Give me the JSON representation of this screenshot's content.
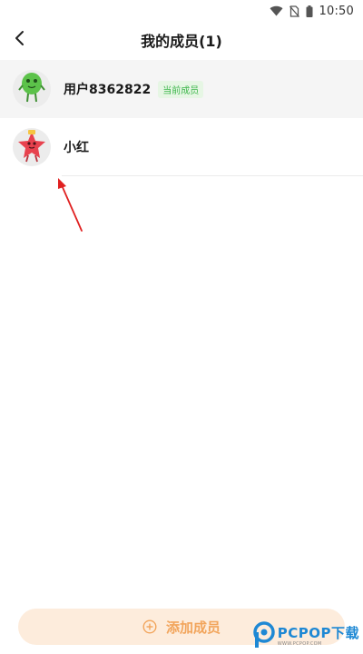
{
  "status_bar": {
    "time": "10:50",
    "icons": [
      "wifi-icon",
      "no-sim-icon",
      "battery-icon"
    ]
  },
  "header": {
    "back_icon": "chevron-left-icon",
    "title": "我的成员(1)"
  },
  "members": [
    {
      "name": "用户8362822",
      "badge": "当前成员",
      "avatar_icon": "green-bean-avatar-icon",
      "current": true
    },
    {
      "name": "小红",
      "avatar_icon": "red-star-avatar-icon",
      "current": false
    }
  ],
  "add_button": {
    "label": "添加成员",
    "icon": "plus-circle-icon"
  },
  "watermark": {
    "brand": "PCPOP下载",
    "sub": "WWW.PCPOP.COM"
  },
  "colors": {
    "accent": "#f2a55c",
    "add_button_bg": "#fdecdc",
    "badge_text": "#3cb64a",
    "badge_bg": "#e6f6e4",
    "annotation_arrow": "#e02020",
    "watermark": "#1e88d4"
  }
}
